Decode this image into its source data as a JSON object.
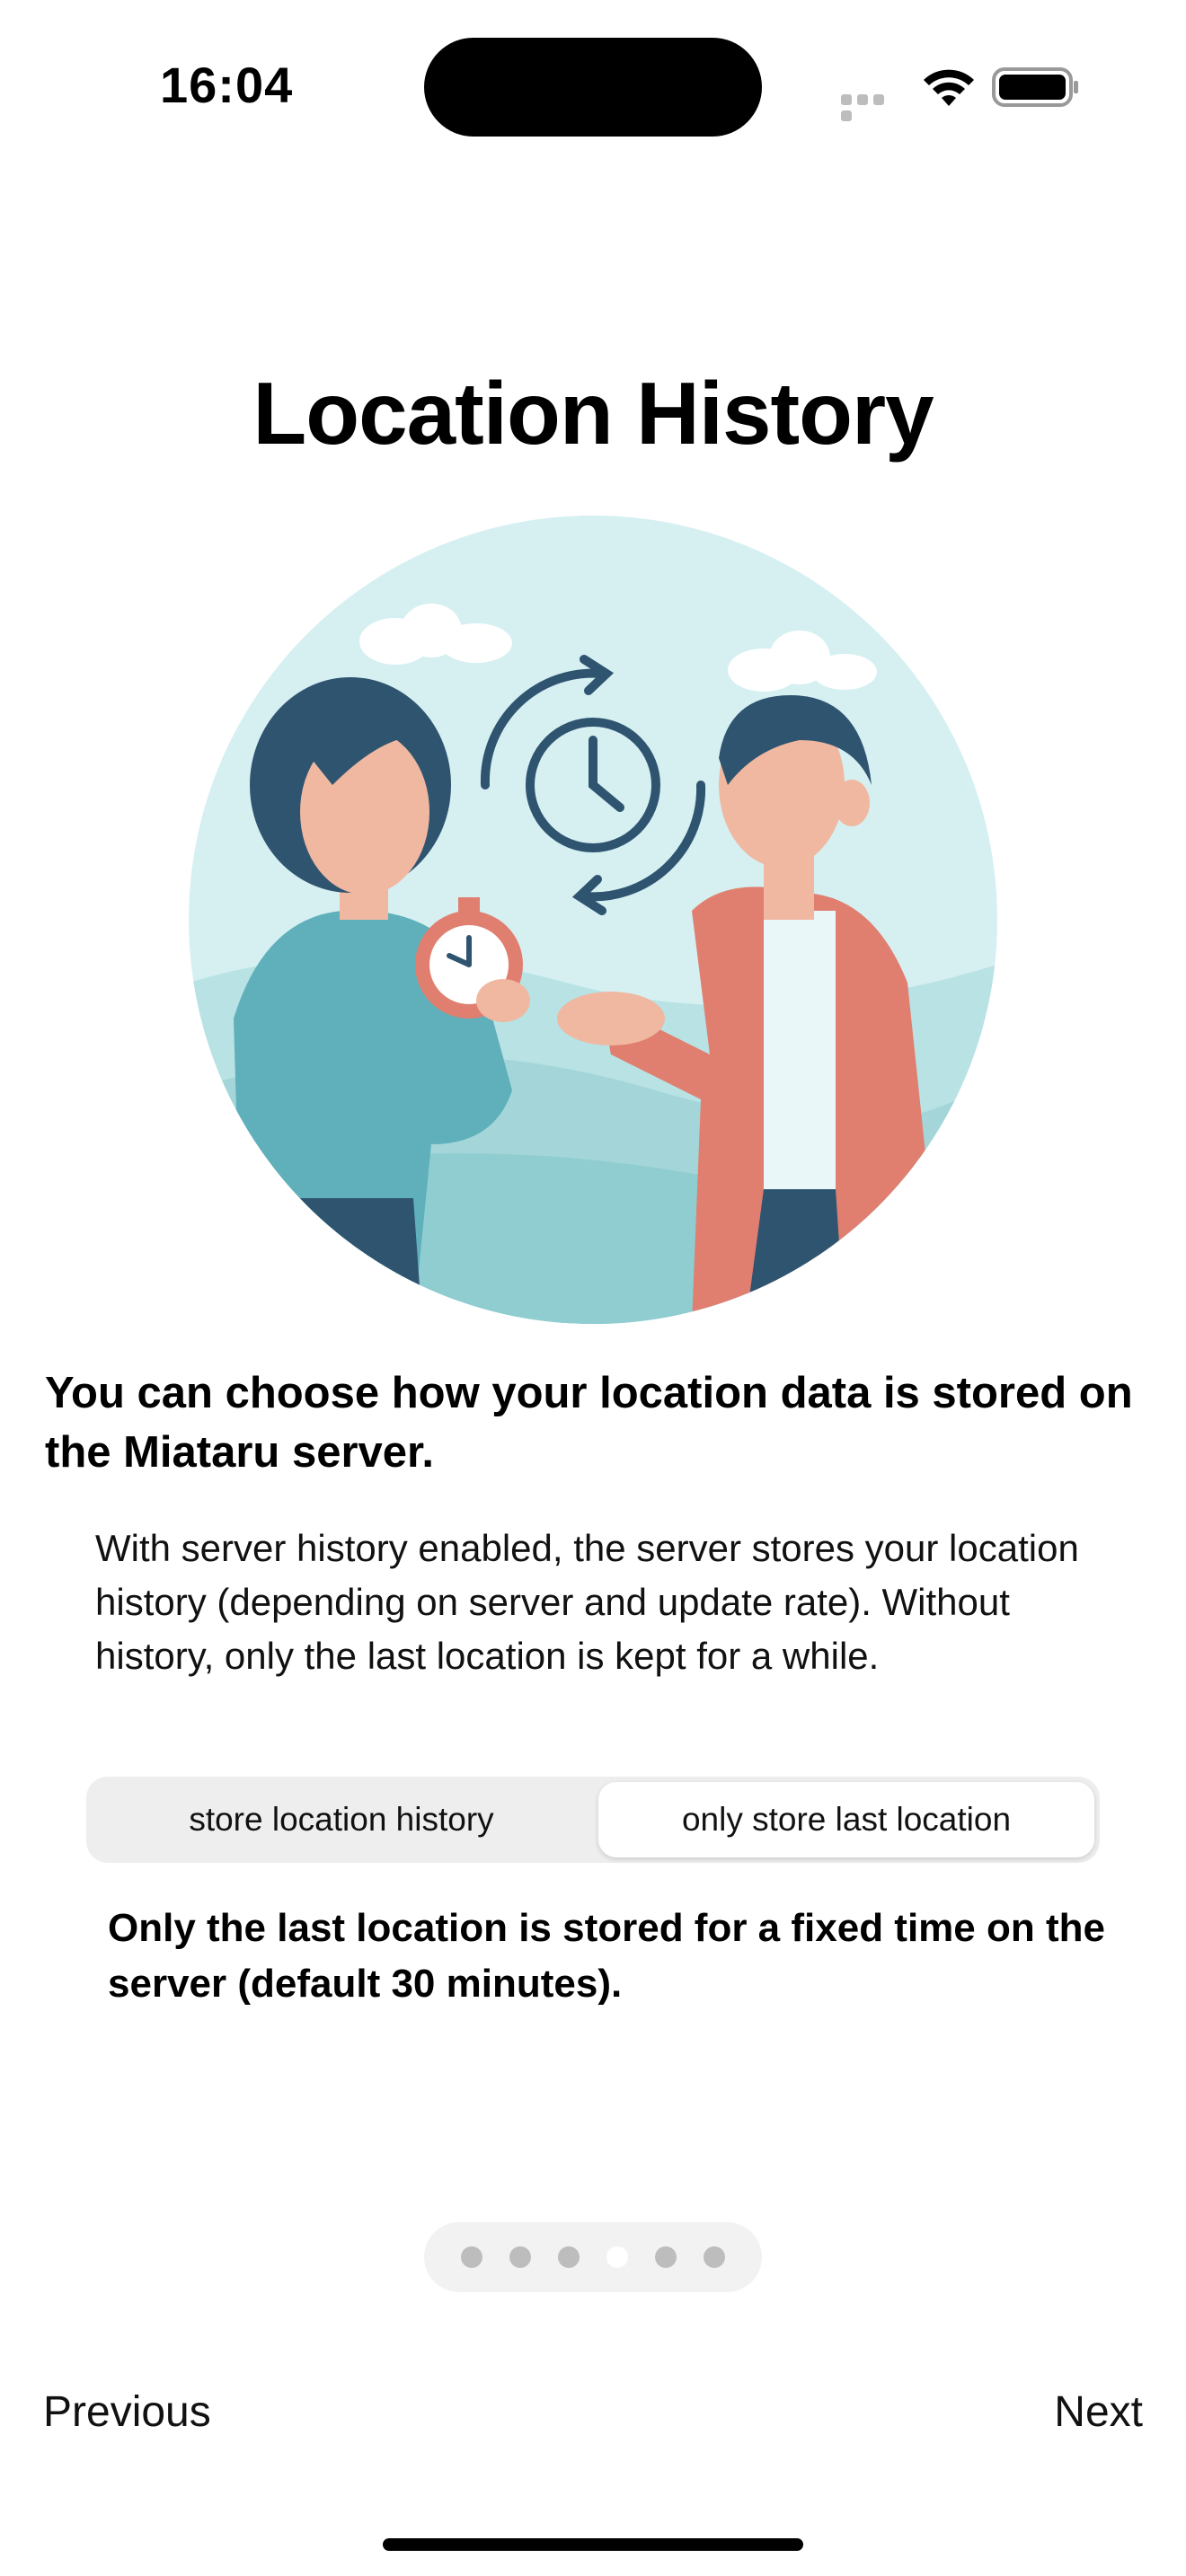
{
  "status_bar": {
    "time": "16:04",
    "icons": [
      "signal-dots-icon",
      "wifi-icon",
      "battery-icon"
    ]
  },
  "page": {
    "title": "Location History",
    "illustration": "woman-holding-stopwatch-man-gesturing-history-clock-icon",
    "headline": "You can choose how your location data is stored on the Miataru server.",
    "body": "With server history enabled, the server stores your location history (depending on server and update rate). Without history, only the last location is kept for a while."
  },
  "segmented_control": {
    "options": [
      "store location history",
      "only store last location"
    ],
    "selected": "only store last location"
  },
  "selected_description": "Only the last location is stored for a fixed time on the server (default 30 minutes).",
  "page_indicator": {
    "total": 6,
    "current": 4
  },
  "navigation": {
    "previous_label": "Previous",
    "next_label": "Next"
  },
  "colors": {
    "accent_circle": "#d6f0f2",
    "teal": "#5fb0ba",
    "navy": "#2f5470",
    "coral": "#e07f6f"
  }
}
